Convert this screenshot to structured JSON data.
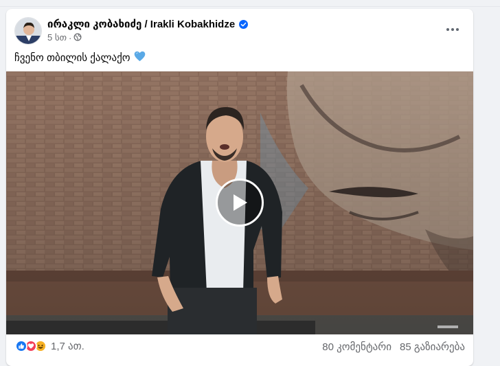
{
  "post": {
    "author": "ირაკლი კობახიძე / Irakli Kobakhidze",
    "time": "5 სთ",
    "separator": "·",
    "caption": "ჩვენო თბილის ქალაქო",
    "caption_emoji": "blue-heart",
    "verified": true
  },
  "footer": {
    "reaction_count": "1,7 ათ.",
    "comments": "80 კომენტარი",
    "shares": "85 გაზიარება",
    "reaction_types": [
      "like",
      "love",
      "haha"
    ]
  },
  "colors": {
    "verified": "#0866ff",
    "like": "#1877f2",
    "love": "#f33e58",
    "haha": "#f7b125",
    "heart": "#5aa9e6"
  }
}
